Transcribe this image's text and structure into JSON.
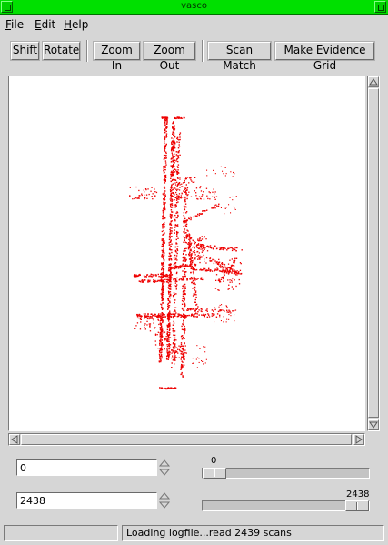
{
  "window": {
    "title": "vasco"
  },
  "menu": [
    {
      "label": "File",
      "key": "F",
      "rest": "ile"
    },
    {
      "label": "Edit",
      "key": "E",
      "rest": "dit"
    },
    {
      "label": "Help",
      "key": "H",
      "rest": "elp"
    }
  ],
  "toolbar": {
    "shift": "Shift",
    "rotate": "Rotate",
    "zoom_in": "Zoom In",
    "zoom_out": "Zoom Out",
    "scan_match": "Scan Match",
    "make_evidence_grid": "Make Evidence Grid"
  },
  "map": {
    "scan_color": "#ee0000",
    "background": "#ffffff"
  },
  "controls": {
    "start_scan": {
      "value": "0"
    },
    "end_scan": {
      "value": "2438"
    },
    "start_slider": {
      "value": 0,
      "max": 2438,
      "label": "0"
    },
    "end_slider": {
      "value": 2438,
      "max": 2438,
      "label": "2438"
    }
  },
  "status": {
    "left": "",
    "message": "Loading logfile...read 2439 scans"
  }
}
